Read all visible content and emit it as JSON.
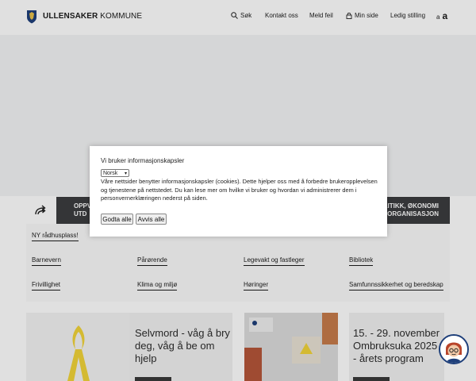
{
  "header": {
    "brand_bold": "ULLENSAKER",
    "brand_light": " KOMMUNE",
    "nav": {
      "search": "Søk",
      "contact": "Kontakt oss",
      "report": "Meld feil",
      "my_page": "Min side",
      "jobs": "Ledig stilling"
    },
    "font_small": "a",
    "font_big": "a"
  },
  "band": {
    "left_line1": "OPPV",
    "left_line2": "UTD",
    "right_line1": "OLITIKK, ØKONOMI",
    "right_line2": "G ORGANISASJON"
  },
  "links": {
    "col1": [
      "NY rådhusplass!",
      "Barnevern",
      "Frivillighet"
    ],
    "col2": [
      "Pårørende",
      "Klima og miljø"
    ],
    "col3": [
      "Legevakt og fastleger",
      "Høringer"
    ],
    "col4": [
      "Bibliotek",
      "Samfunnssikkerhet og beredskap"
    ]
  },
  "cards": {
    "card1_title": "Selvmord - våg å bry deg, våg å be om hjelp",
    "card3_title": "15. - 29. november Ombruksuka 2025 - årets program"
  },
  "cookie": {
    "title": "Vi bruker informasjonskapsler",
    "language": "Norsk",
    "text": "Våre nettsider benytter informasjonskapsler (cookies). Dette hjelper oss med å forbedre brukeropplevelsen og tjenestene på nettstedet. Du kan lese mer om hvilke vi bruker og hvordan vi administrerer dem i personvernerklæringen nederst på siden.",
    "accept": "Godta alle",
    "reject": "Avvis alle"
  },
  "colors": {
    "band": "#3c3d3f",
    "brand_blue": "#1e3f7a",
    "ribbon_yellow": "#f2d43a"
  }
}
